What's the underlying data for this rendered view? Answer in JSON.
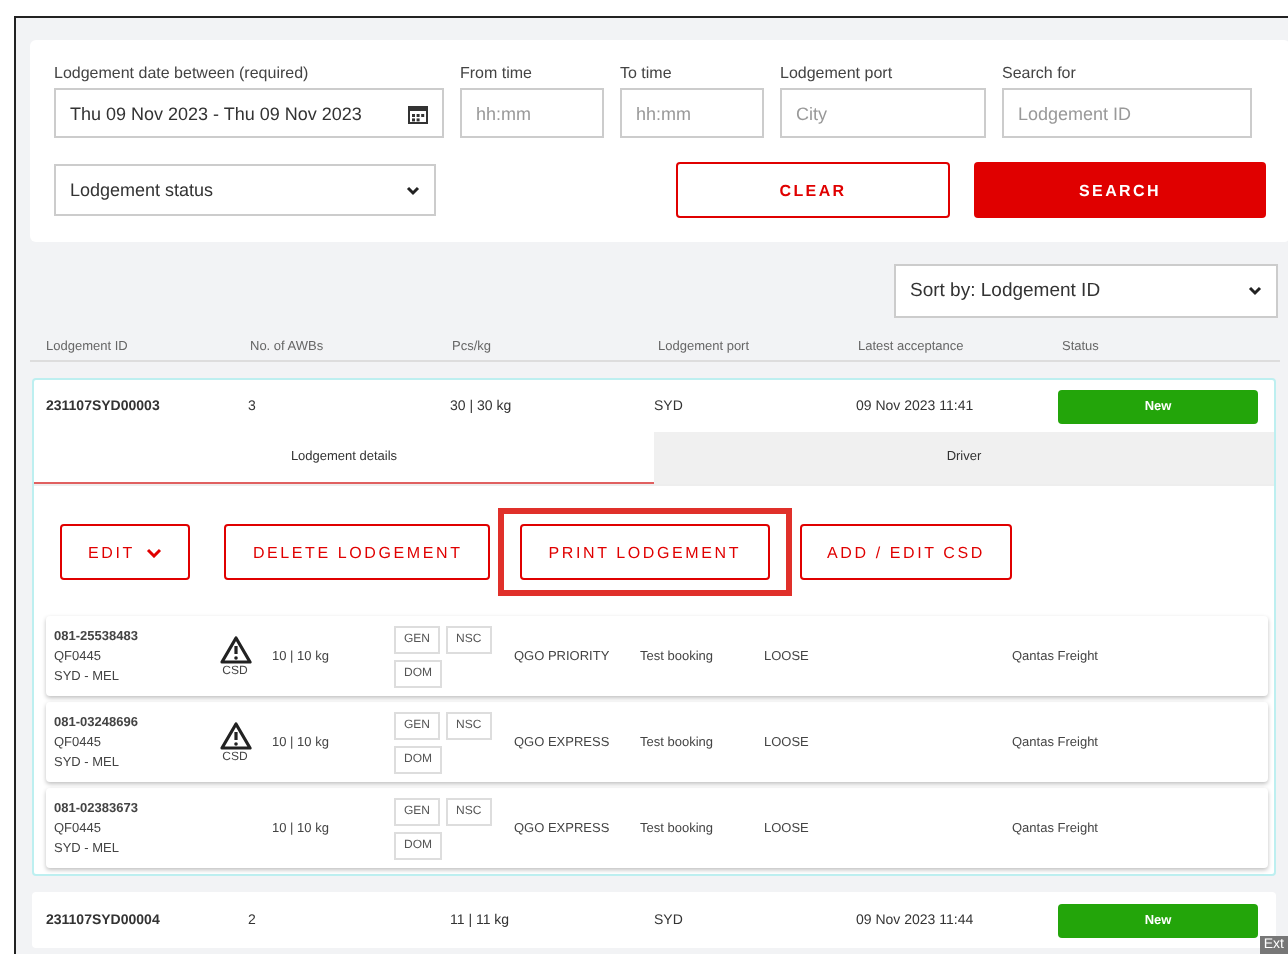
{
  "filters": {
    "date": {
      "label": "Lodgement date between (required)",
      "value": "Thu 09 Nov 2023 - Thu 09 Nov 2023"
    },
    "from_time": {
      "label": "From time",
      "placeholder": "hh:mm"
    },
    "to_time": {
      "label": "To time",
      "placeholder": "hh:mm"
    },
    "port": {
      "label": "Lodgement port",
      "placeholder": "City"
    },
    "search_for": {
      "label": "Search for",
      "placeholder": "Lodgement ID"
    },
    "status": {
      "value": "Lodgement status"
    },
    "buttons": [
      {
        "label": "CLEAR",
        "kind": "outline"
      },
      {
        "label": "SEARCH",
        "kind": "primary"
      }
    ]
  },
  "sort": {
    "value": "Sort by: Lodgement ID"
  },
  "table": {
    "columns": [
      "Lodgement ID",
      "No. of AWBs",
      "Pcs/kg",
      "Lodgement port",
      "Latest acceptance",
      "Status"
    ],
    "rows": [
      {
        "id": "231107SYD00003",
        "awbs": "3",
        "pcs": "30 | 30 kg",
        "port": "SYD",
        "acceptance": "09 Nov 2023 11:41",
        "status": "New",
        "expanded": true,
        "tabs": [
          {
            "label": "Lodgement details",
            "selected": true
          },
          {
            "label": "Driver",
            "selected": false
          }
        ],
        "actions": [
          {
            "label": "EDIT",
            "dropdown": true,
            "highlighted": false
          },
          {
            "label": "DELETE LODGEMENT",
            "dropdown": false,
            "highlighted": false
          },
          {
            "label": "PRINT LODGEMENT",
            "dropdown": false,
            "highlighted": true
          },
          {
            "label": "ADD / EDIT CSD",
            "dropdown": false,
            "highlighted": false
          }
        ],
        "awbs_list": [
          {
            "awb": "081-25538483",
            "flight": "QF0445",
            "route": "SYD - MEL",
            "warning": "CSD",
            "pcs": "10 | 10 kg",
            "tags": [
              "GEN",
              "NSC",
              "DOM"
            ],
            "product": "QGO PRIORITY",
            "note": "Test booking",
            "type": "LOOSE",
            "shipper": "Qantas Freight"
          },
          {
            "awb": "081-03248696",
            "flight": "QF0445",
            "route": "SYD - MEL",
            "warning": "CSD",
            "pcs": "10 | 10 kg",
            "tags": [
              "GEN",
              "NSC",
              "DOM"
            ],
            "product": "QGO EXPRESS",
            "note": "Test booking",
            "type": "LOOSE",
            "shipper": "Qantas Freight"
          },
          {
            "awb": "081-02383673",
            "flight": "QF0445",
            "route": "SYD - MEL",
            "pcs": "10 | 10 kg",
            "tags": [
              "GEN",
              "NSC",
              "DOM"
            ],
            "product": "QGO EXPRESS",
            "note": "Test booking",
            "type": "LOOSE",
            "shipper": "Qantas Freight"
          }
        ]
      },
      {
        "id": "231107SYD00004",
        "awbs": "2",
        "pcs": "11 | 11 kg",
        "port": "SYD",
        "acceptance": "09 Nov 2023 11:44",
        "status": "New",
        "expanded": false
      }
    ]
  },
  "tooltip": "Ext"
}
